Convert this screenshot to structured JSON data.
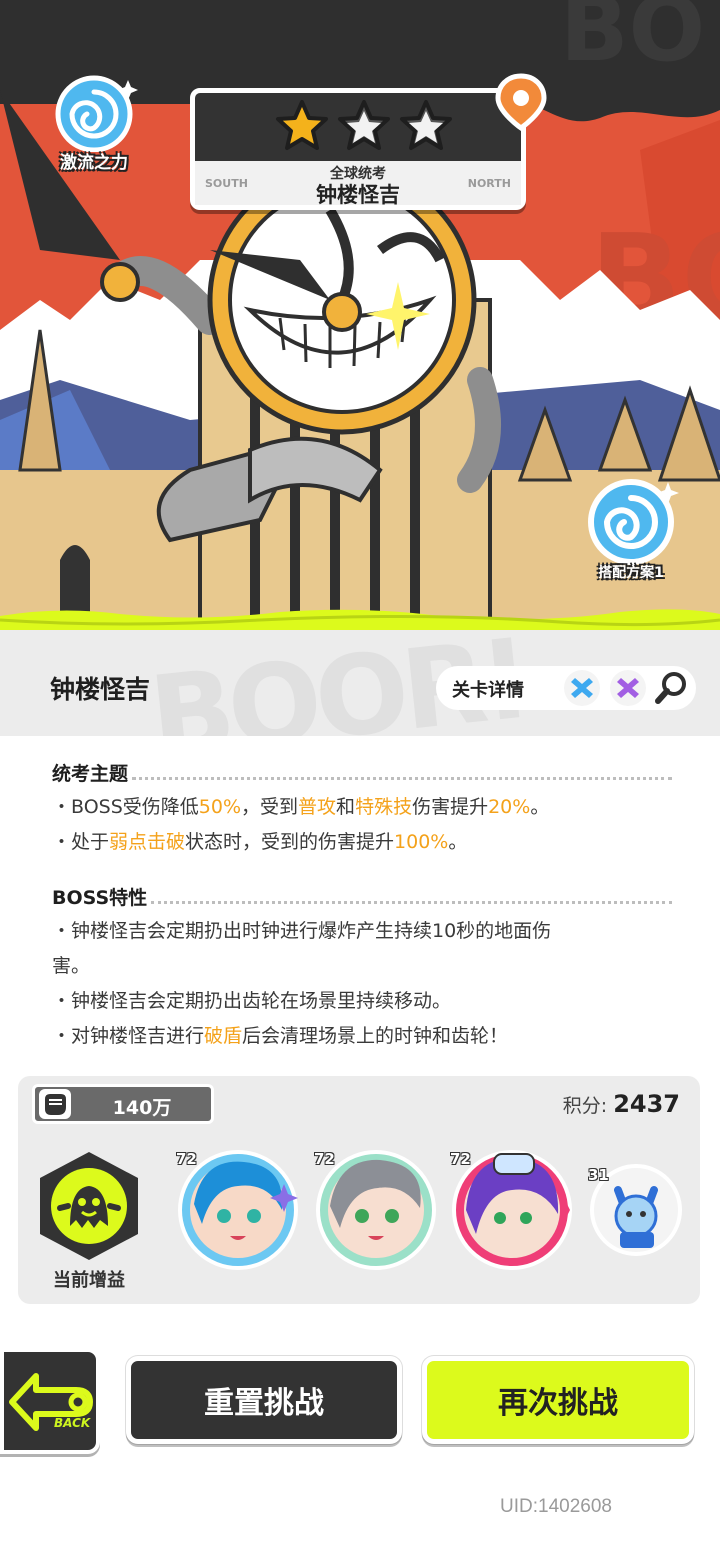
{
  "hero": {
    "element_label": "激流之力",
    "stars_earned": 1,
    "stars_total": 3,
    "stage_subtitle": "全球统考",
    "stage_name": "钟楼怪吉",
    "nav_left": "SOUTH",
    "nav_right": "NORTH",
    "loadout_label": "搭配方案1"
  },
  "header": {
    "title": "钟楼怪吉",
    "detail_label": "关卡详情"
  },
  "rules": {
    "theme_title": "统考主题",
    "theme_line1": {
      "a": "・BOSS受伤降低",
      "b": "50%",
      "c": "，受到",
      "d": "普攻",
      "e": "和",
      "f": "特殊技",
      "g": "伤害提升",
      "h": "20%",
      "i": "。"
    },
    "theme_line2": {
      "a": "・处于",
      "b": "弱点击破",
      "c": "状态时，受到的伤害提升",
      "d": "100%",
      "e": "。"
    },
    "boss_title": "BOSS特性",
    "boss_line1a": "・钟楼怪吉会定期扔出时钟进行爆炸产生持续10秒的地面伤",
    "boss_line1b": "害。",
    "boss_line2": "・钟楼怪吉会定期扔出齿轮在场景里持续移动。",
    "boss_line3": {
      "a": "・对钟楼怪吉进行",
      "b": "破盾",
      "c": "后会清理场景上的时钟和齿轮！"
    }
  },
  "team": {
    "power_value": "140万",
    "score_label": "积分:",
    "score_value": "2437",
    "buff_label": "当前增益",
    "members": [
      {
        "level": "72"
      },
      {
        "level": "72"
      },
      {
        "level": "72"
      },
      {
        "level": "31"
      }
    ]
  },
  "buttons": {
    "back_label": "BACK",
    "reset_label": "重置挑战",
    "again_label": "再次挑战"
  },
  "footer": {
    "uid": "UID:1402608"
  },
  "colors": {
    "accent_lime": "#dcfa1c",
    "highlight_orange": "#f4a21b",
    "dark": "#333333",
    "hero_red": "#e2553a"
  },
  "icons": [
    "water-swirl-icon",
    "star-icon",
    "map-pin-icon",
    "search-icon",
    "fist-icon",
    "buff-ghost-icon",
    "back-arrow-icon"
  ]
}
